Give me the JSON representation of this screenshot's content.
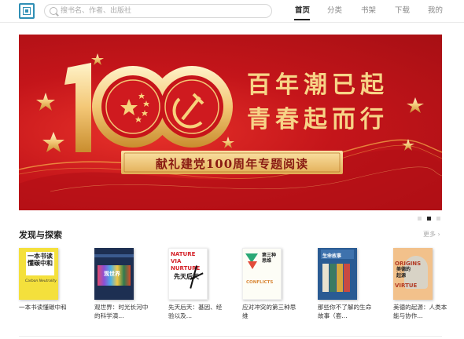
{
  "header": {
    "search_placeholder": "搜书名、作者、出版社",
    "nav": [
      {
        "label": "首页",
        "active": true
      },
      {
        "label": "分类",
        "active": false
      },
      {
        "label": "书架",
        "active": false
      },
      {
        "label": "下载",
        "active": false
      },
      {
        "label": "我的",
        "active": false
      }
    ]
  },
  "banner": {
    "number": "100",
    "slogan_line1": "百年潮已起",
    "slogan_line2": "青春起而行",
    "caption": "献礼建党100周年专题阅读",
    "slide_count": 3,
    "active_slide": 2,
    "colors": {
      "background": "#c4151a",
      "gold": "#f3c776"
    }
  },
  "section": {
    "title": "发现与探索",
    "more_label": "更多",
    "books": [
      {
        "title": "一本书读懂碳中和",
        "cover_text": "一本书读懂碳中和",
        "cover_subtitle": "Carbon Neutrality",
        "cover_color": "#f4e03c"
      },
      {
        "title": "观世界：时光长河中的科学演...",
        "cover_text": "观世界",
        "cover_color": "#1d2f52"
      },
      {
        "title": "先天后天：基因、经验以及...",
        "cover_text": "先天后天",
        "cover_subtitle": "NATURE VIA NURTURE",
        "cover_color": "#ffffff"
      },
      {
        "title": "应对冲突的第三种思维",
        "cover_text": "第三种思维",
        "cover_subtitle": "CONFLICTS",
        "cover_color": "#fdfdf6"
      },
      {
        "title": "那些你不了解的生命故事（套...",
        "cover_text": "生命故事",
        "cover_color": "#2a5b93"
      },
      {
        "title": "美德的起源：人类本能与协作...",
        "cover_text": "美德的起源",
        "cover_subtitle": "ORIGINS VIRTUE",
        "cover_color": "#f2c18b"
      }
    ]
  }
}
